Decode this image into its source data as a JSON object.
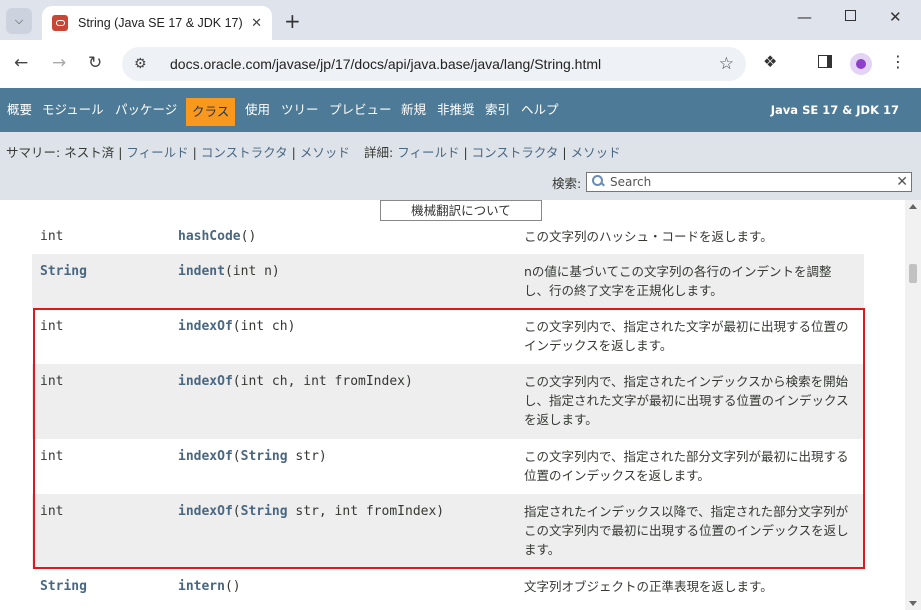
{
  "browser": {
    "tab_title": "String (Java SE 17 & JDK 17)",
    "tab_close": "✕",
    "new_tab": "+",
    "url": "docs.oracle.com/javase/jp/17/docs/api/java.base/java/lang/String.html",
    "icons": [
      "tab-search-icon",
      "oracle-favicon",
      "back-arrow-icon",
      "forward-arrow-icon",
      "reload-icon",
      "site-info-icon",
      "star-icon",
      "extensions-icon",
      "side-panel-icon",
      "profile-icon",
      "menu-icon",
      "minimize-icon",
      "maximize-icon",
      "close-window-icon"
    ]
  },
  "navbar": {
    "items": [
      "概要",
      "モジュール",
      "パッケージ",
      "クラス",
      "使用",
      "ツリー",
      "プレビュー",
      "新規",
      "非推奨",
      "索引",
      "ヘルプ"
    ],
    "active": "クラス",
    "brand": "Java SE 17 & JDK 17",
    "accent": "#f8981d",
    "background": "#4d7a97"
  },
  "subnav": {
    "summary_label": "サマリー:",
    "summary_nested": "ネスト済",
    "summary_field": "フィールド",
    "summary_ctor": "コンストラクタ",
    "summary_method": "メソッド",
    "detail_label": "詳細:",
    "detail_field": "フィールド",
    "detail_ctor": "コンストラクタ",
    "detail_method": "メソッド",
    "separator": "|",
    "search_label": "検索:",
    "search_placeholder": "Search",
    "search_clear": "✕"
  },
  "content": {
    "machine_translation_button": "機械翻訳について",
    "rows": [
      {
        "type": "int",
        "method": "hashCode",
        "params": "()",
        "desc": "この文字列のハッシュ・コードを返します。"
      },
      {
        "type": "String",
        "method": "indent",
        "params": "(int n)",
        "desc": "nの値に基づいてこの文字列の各行のインデントを調整し、行の終了文字を正規化します。"
      },
      {
        "type": "int",
        "method": "indexOf",
        "params": "(int ch)",
        "desc": "この文字列内で、指定された文字が最初に出現する位置のインデックスを返します。"
      },
      {
        "type": "int",
        "method": "indexOf",
        "params": "(int ch, int fromIndex)",
        "desc": "この文字列内で、指定されたインデックスから検索を開始し、指定された文字が最初に出現する位置のインデックスを返します。"
      },
      {
        "type": "int",
        "method": "indexOf",
        "params_type": "String",
        "params_rest": " str)",
        "desc": "この文字列内で、指定された部分文字列が最初に出現する位置のインデックスを返します。"
      },
      {
        "type": "int",
        "method": "indexOf",
        "params_type": "String",
        "params_rest": " str, int fromIndex)",
        "desc": "指定されたインデックス以降で、指定された部分文字列がこの文字列内で最初に出現する位置のインデックスを返します。"
      },
      {
        "type": "String",
        "method": "intern",
        "params": "()",
        "desc": "文字列オブジェクトの正準表現を返します。"
      }
    ],
    "open_paren": "(",
    "highlight_color": "#e01818"
  }
}
